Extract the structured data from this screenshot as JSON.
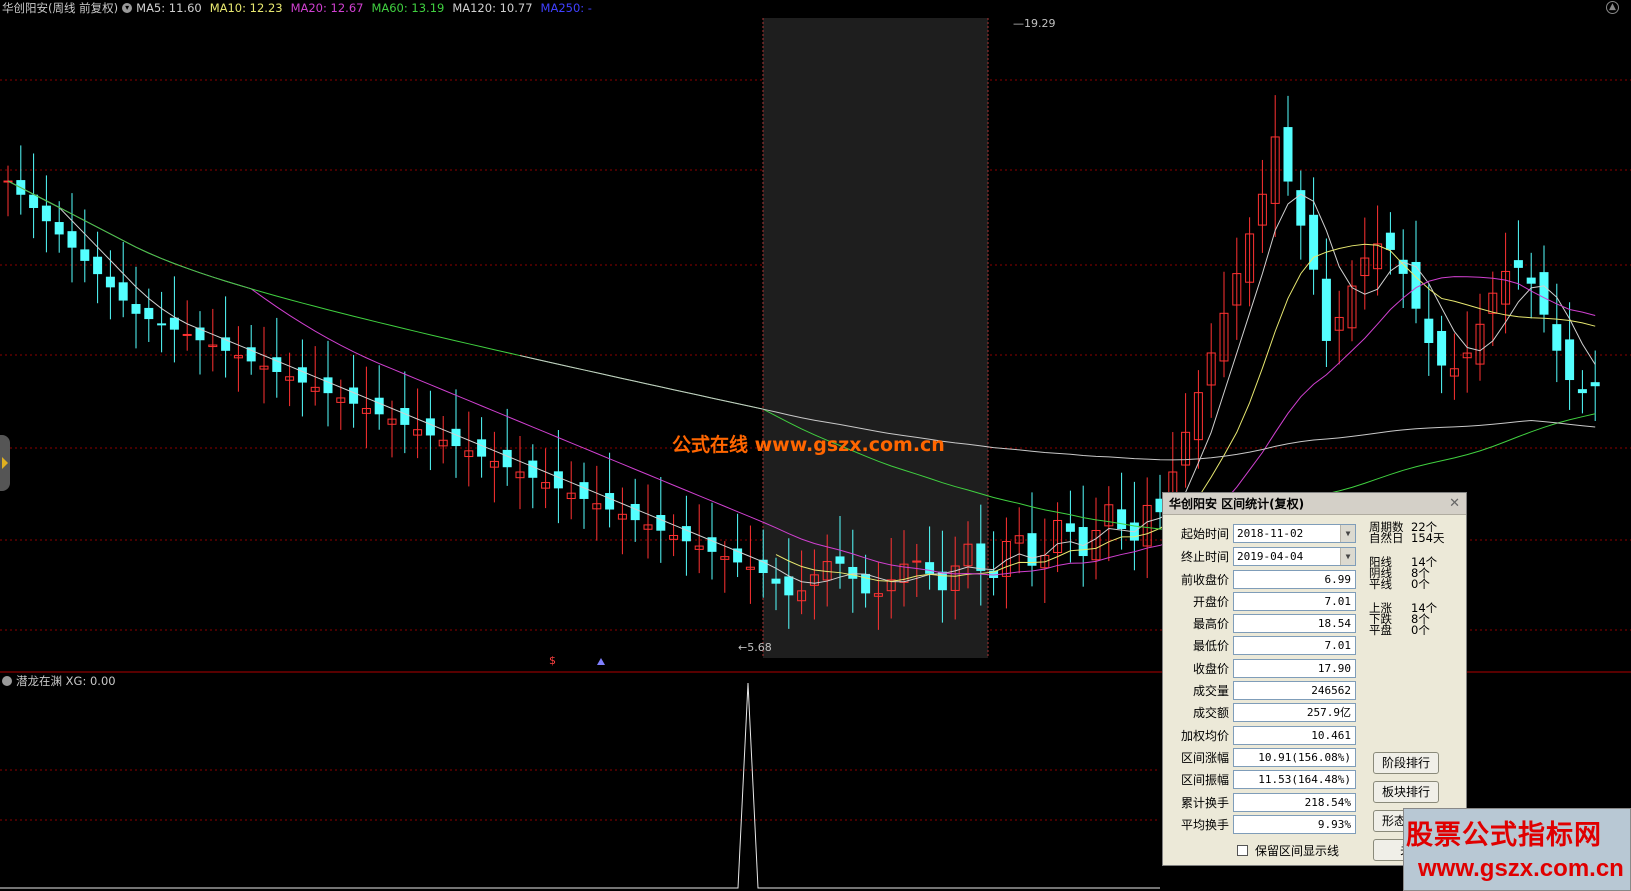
{
  "header": {
    "title": "华创阳安(周线 前复权)",
    "ma_items": [
      {
        "label": "MA5: 11.60",
        "color": "#d0d0d0"
      },
      {
        "label": "MA10: 12.23",
        "color": "#e8e870"
      },
      {
        "label": "MA20: 12.67",
        "color": "#d040d0"
      },
      {
        "label": "MA60: 13.19",
        "color": "#40d040"
      },
      {
        "label": "MA120: 10.77",
        "color": "#d0d0d0"
      },
      {
        "label": "MA250: -",
        "color": "#4040ff"
      }
    ]
  },
  "price_labels": {
    "high": "19.29",
    "low": "5.68"
  },
  "watermark": "公式在线 www.gszx.com.cn",
  "lower_panel": {
    "title": "潜龙在渊 XG: 0.00"
  },
  "markers": {
    "left": "$"
  },
  "dialog": {
    "title": "华创阳安 区间统计(复权)",
    "start_label": "起始时间",
    "start_value": "2018-11-02",
    "end_label": "终止时间",
    "end_value": "2019-04-04",
    "fields": [
      {
        "label": "前收盘价",
        "value": "6.99"
      },
      {
        "label": "开盘价",
        "value": "7.01"
      },
      {
        "label": "最高价",
        "value": "18.54"
      },
      {
        "label": "最低价",
        "value": "7.01"
      },
      {
        "label": "收盘价",
        "value": "17.90"
      },
      {
        "label": "成交量",
        "value": "246562"
      },
      {
        "label": "成交额",
        "value": "257.9亿"
      },
      {
        "label": "加权均价",
        "value": "10.461"
      },
      {
        "label": "区间涨幅",
        "value": "10.91(156.08%)"
      },
      {
        "label": "区间振幅",
        "value": "11.53(164.48%)"
      },
      {
        "label": "累计换手",
        "value": "218.54%"
      },
      {
        "label": "平均换手",
        "value": "9.93%"
      }
    ],
    "stats": [
      [
        {
          "k": "周期数",
          "v": "22个"
        },
        {
          "k": "自然日",
          "v": "154天"
        }
      ],
      [
        {
          "k": "阳线",
          "v": "14个"
        },
        {
          "k": "阴线",
          "v": "8个"
        },
        {
          "k": "平线",
          "v": "0个"
        }
      ],
      [
        {
          "k": "上涨",
          "v": "14个"
        },
        {
          "k": "下跌",
          "v": "8个"
        },
        {
          "k": "平盘",
          "v": "0个"
        }
      ]
    ],
    "buttons": [
      "阶段排行",
      "板块排行",
      "形态匹配",
      "关"
    ],
    "checkbox_label": "保留区间显示线"
  },
  "banner": {
    "line1": "股票公式指标网",
    "line2": "www.gszx.com.cn"
  },
  "colors": {
    "up": "#ff3232",
    "down": "#54ffff",
    "ma5": "#d0d0d0",
    "ma10": "#e8e870",
    "ma20": "#d040d0",
    "ma60": "#40d040",
    "ma120": "#c8c8c8",
    "grid": "#8b0000"
  }
}
